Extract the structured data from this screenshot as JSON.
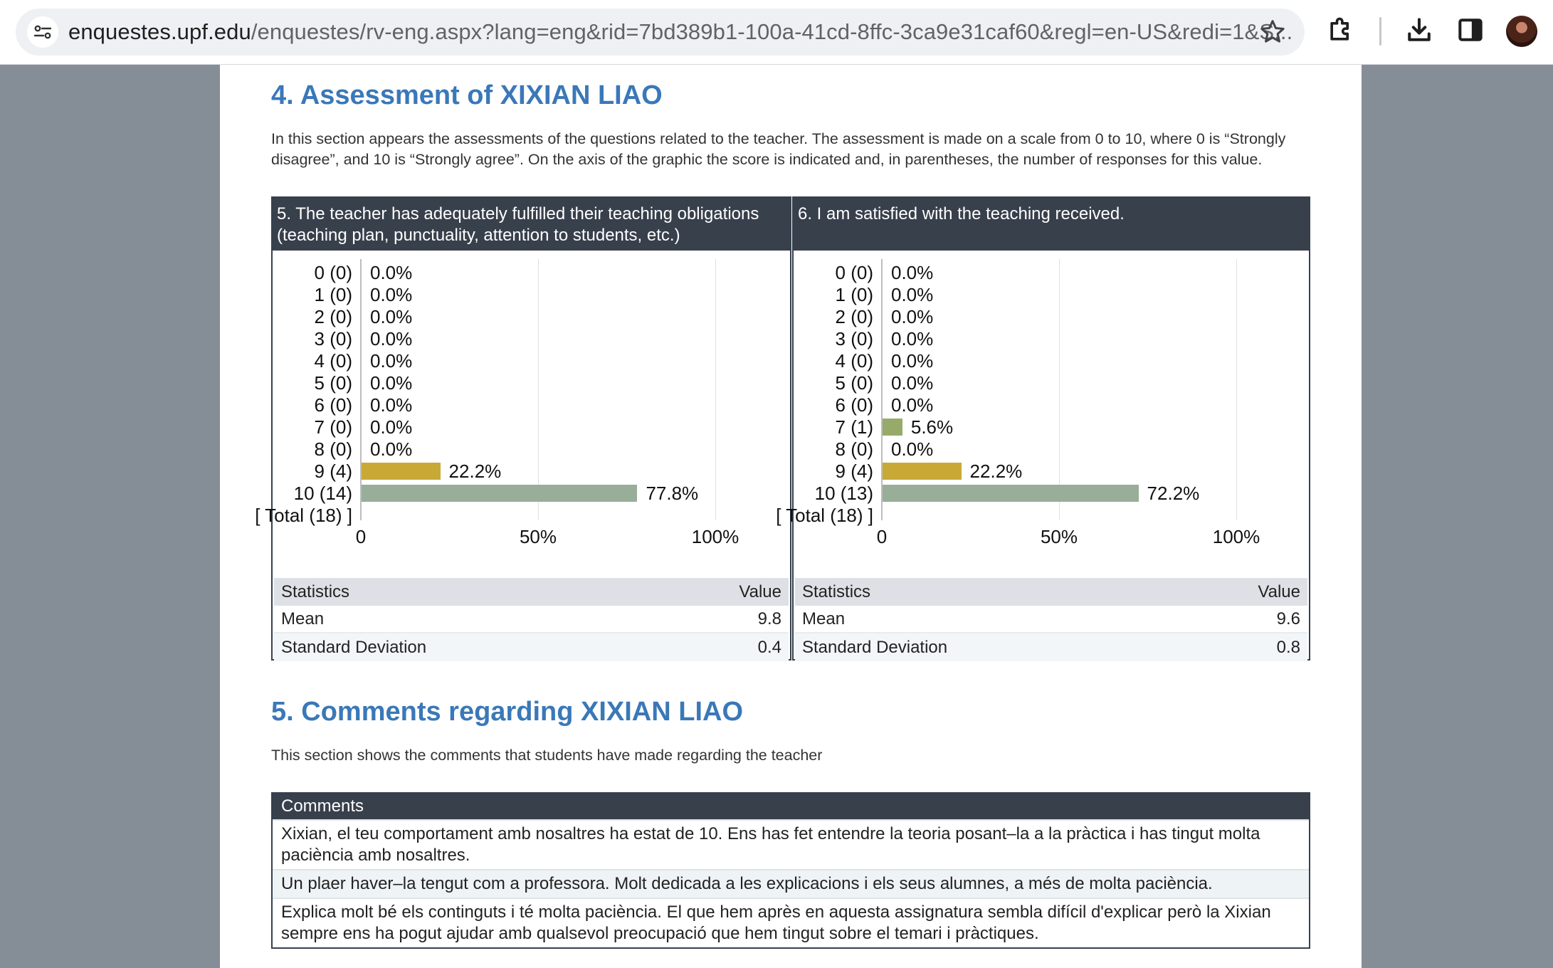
{
  "browser": {
    "url_host": "enquestes.upf.edu",
    "url_rest": "/enquestes/rv-eng.aspx?lang=eng&rid=7bd389b1-100a-41cd-8ffc-3ca9e31caf60&regl=en-US&redi=1&S...",
    "icons": [
      "tune-icon",
      "star-icon",
      "extensions-icon",
      "download-icon",
      "side-panel-icon",
      "avatar"
    ]
  },
  "section4": {
    "title": "4. Assessment of XIXIAN LIAO",
    "intro": "In this section appears the assessments of the questions related to the teacher. The assessment is made on a scale from 0 to 10, where 0 is “Strongly disagree”, and 10 is “Strongly agree”. On the axis of the graphic the score is indicated and, in parentheses, the number of responses for this value."
  },
  "questions": [
    {
      "title": "5. The teacher has adequately fulfilled their teaching obligations (teaching plan, punctuality, attention to students, etc.)",
      "stats_header": [
        "Statistics",
        "Value"
      ],
      "stats": [
        {
          "label": "Mean",
          "value": "9.8"
        },
        {
          "label": "Standard Deviation",
          "value": "0.4"
        }
      ]
    },
    {
      "title": "6. I am satisfied with the teaching received.",
      "stats_header": [
        "Statistics",
        "Value"
      ],
      "stats": [
        {
          "label": "Mean",
          "value": "9.6"
        },
        {
          "label": "Standard Deviation",
          "value": "0.8"
        }
      ]
    }
  ],
  "chart_data": [
    {
      "type": "bar",
      "orientation": "horizontal",
      "categories": [
        "0 (0)",
        "1 (0)",
        "2 (0)",
        "3 (0)",
        "4 (0)",
        "5 (0)",
        "6 (0)",
        "7 (0)",
        "8 (0)",
        "9 (4)",
        "10 (14)",
        "[ Total (18) ]"
      ],
      "values": [
        0,
        0,
        0,
        0,
        0,
        0,
        0,
        0,
        0,
        22.2,
        77.8,
        null
      ],
      "value_labels": [
        "0.0%",
        "0.0%",
        "0.0%",
        "0.0%",
        "0.0%",
        "0.0%",
        "0.0%",
        "0.0%",
        "0.0%",
        "22.2%",
        "77.8%",
        ""
      ],
      "bar_colors": [
        "#98aa6a",
        "#98aa6a",
        "#98aa6a",
        "#98aa6a",
        "#98aa6a",
        "#98aa6a",
        "#98aa6a",
        "#98aa6a",
        "#98aa6a",
        "#c9a936",
        "#98ae98",
        "#98aa6a"
      ],
      "x_ticks": [
        "0",
        "50%",
        "100%"
      ],
      "xlim": [
        0,
        100
      ],
      "grid": true
    },
    {
      "type": "bar",
      "orientation": "horizontal",
      "categories": [
        "0 (0)",
        "1 (0)",
        "2 (0)",
        "3 (0)",
        "4 (0)",
        "5 (0)",
        "6 (0)",
        "7 (1)",
        "8 (0)",
        "9 (4)",
        "10 (13)",
        "[ Total (18) ]"
      ],
      "values": [
        0,
        0,
        0,
        0,
        0,
        0,
        0,
        5.6,
        0,
        22.2,
        72.2,
        null
      ],
      "value_labels": [
        "0.0%",
        "0.0%",
        "0.0%",
        "0.0%",
        "0.0%",
        "0.0%",
        "0.0%",
        "5.6%",
        "0.0%",
        "22.2%",
        "72.2%",
        ""
      ],
      "bar_colors": [
        "#98aa6a",
        "#98aa6a",
        "#98aa6a",
        "#98aa6a",
        "#98aa6a",
        "#98aa6a",
        "#98aa6a",
        "#98aa6a",
        "#98aa6a",
        "#c9a936",
        "#98ae98",
        "#98aa6a"
      ],
      "x_ticks": [
        "0",
        "50%",
        "100%"
      ],
      "xlim": [
        0,
        100
      ],
      "grid": true
    }
  ],
  "section5": {
    "title": "5. Comments regarding XIXIAN LIAO",
    "intro": "This section shows the comments that students have made regarding the teacher",
    "header": "Comments",
    "comments": [
      "Xixian, el teu comportament amb nosaltres ha estat de 10. Ens has fet entendre la teoria posant–la a la pràctica i has tingut molta paciència amb nosaltres.",
      "Un plaer haver–la tengut com a professora. Molt dedicada a les explicacions i els seus alumnes, a més de molta paciència.",
      "Explica molt bé els continguts i té molta paciència. El que hem après en aquesta assignatura sembla difícil d'explicar però la Xixian sempre ens ha pogut ajudar amb qualsevol preocupació que hem tingut sobre el temari i pràctiques."
    ]
  }
}
